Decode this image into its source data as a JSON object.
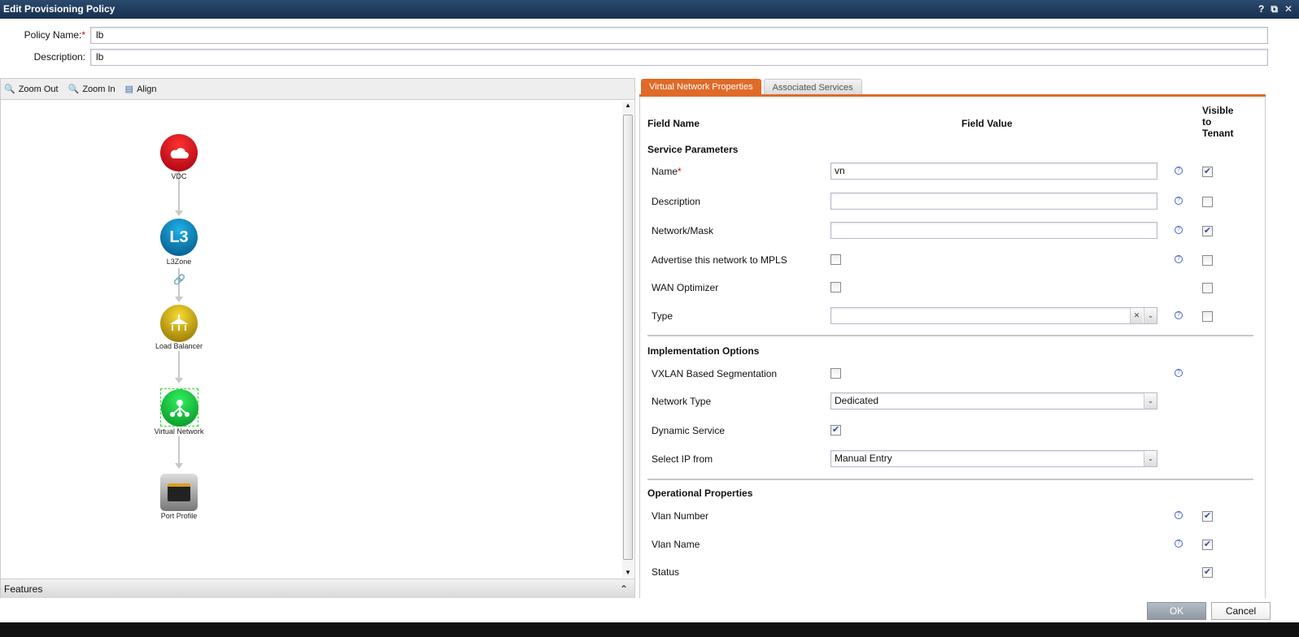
{
  "window": {
    "title": "Edit Provisioning Policy",
    "icons": [
      "help-icon",
      "restore-icon",
      "close-icon"
    ]
  },
  "policy": {
    "name_label": "Policy Name:",
    "required_mark": "*",
    "name_value": "lb",
    "description_label": "Description:",
    "description_value": "lb"
  },
  "toolbar": {
    "zoom_out": "Zoom Out",
    "zoom_in": "Zoom In",
    "align": "Align"
  },
  "diagram": {
    "nodes": [
      {
        "label": "VDC",
        "color": "#d0101a"
      },
      {
        "label": "L3Zone",
        "icon_text": "L3",
        "color": "#0a74b0"
      },
      {
        "label": "Load Balancer",
        "color": "#c09a10"
      },
      {
        "label": "Virtual Network",
        "color": "#14b030"
      },
      {
        "label": "Port Profile",
        "color": "#777777"
      }
    ]
  },
  "features": {
    "label": "Features"
  },
  "tabs": [
    {
      "label": "Virtual Network Properties",
      "active": true
    },
    {
      "label": "Associated Services",
      "active": false
    }
  ],
  "table": {
    "col_field_name": "Field Name",
    "col_field_value": "Field Value",
    "col_visible": "Visible to Tenant"
  },
  "sections": {
    "service": "Service Parameters",
    "implementation": "Implementation Options",
    "operational": "Operational Properties"
  },
  "rows": [
    {
      "label": "Name",
      "required": true,
      "type": "text",
      "value": "vn",
      "help": true,
      "visible": true
    },
    {
      "label": "Description",
      "type": "text",
      "value": "",
      "help": true,
      "visible": false
    },
    {
      "label": "Network/Mask",
      "type": "text",
      "value": "",
      "help": true,
      "visible": true
    },
    {
      "label": "Advertise this network to MPLS",
      "type": "checkbox",
      "checked": false,
      "help": true,
      "visible": false
    },
    {
      "label": "WAN Optimizer",
      "type": "checkbox",
      "checked": false,
      "help": false,
      "visible": false
    },
    {
      "label": "Type",
      "type": "combo",
      "value": "",
      "help": true,
      "visible": false
    },
    {
      "label": "VXLAN Based Segmentation",
      "type": "checkbox",
      "checked": false,
      "help": true
    },
    {
      "label": "Network Type",
      "type": "select",
      "value": "Dedicated"
    },
    {
      "label": "Dynamic Service",
      "type": "checkbox",
      "checked": true
    },
    {
      "label": "Select IP from",
      "type": "select",
      "value": "Manual Entry"
    },
    {
      "label": "Vlan Number",
      "type": "none",
      "help": true,
      "visible": true
    },
    {
      "label": "Vlan Name",
      "type": "none",
      "help": true,
      "visible": true
    },
    {
      "label": "Status",
      "type": "none",
      "help": false,
      "visible": true
    }
  ],
  "buttons": {
    "ok": "OK",
    "cancel": "Cancel"
  },
  "colors": {
    "accent": "#e06a28",
    "titlebar": "#1c375a"
  }
}
